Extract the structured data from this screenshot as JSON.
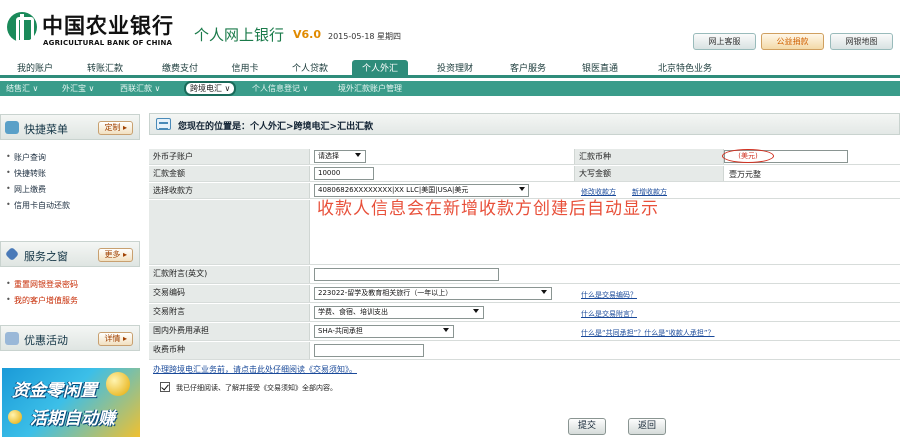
{
  "header": {
    "bank_name_cn": "中国农业银行",
    "bank_name_en": "AGRICULTURAL BANK OF CHINA",
    "product": "个人网上银行",
    "version": "V6.0",
    "date": "2015-05-18 星期四",
    "buttons": [
      "网上客服",
      "公益捐款",
      "网银地图"
    ]
  },
  "nav": {
    "items": [
      "我的账户",
      "转账汇款",
      "缴费支付",
      "信用卡",
      "个人贷款",
      "个人外汇",
      "投资理财",
      "客户服务",
      "银医直通",
      "北京特色业务"
    ],
    "active_index": 5
  },
  "subnav": {
    "items": [
      "结售汇 ∨",
      "外汇宝 ∨",
      "西联汇款 ∨",
      "跨境电汇 ∨",
      "个人信息登记 ∨",
      "境外汇款账户管理"
    ],
    "active_index": 3
  },
  "sidebar": {
    "quick_menu": {
      "title": "快捷菜单",
      "button": "定制 ▸",
      "links": [
        "账户查询",
        "快捷转账",
        "网上缴费",
        "信用卡自动还款"
      ]
    },
    "service": {
      "title": "服务之窗",
      "button": "更多 ▸",
      "links": [
        "重置网银登录密码",
        "我的客户增值服务"
      ]
    },
    "offers": {
      "title": "优惠活动",
      "button": "详情 ▸"
    },
    "promo": {
      "line1": "资金零闲置",
      "line2": "活期自动赚"
    }
  },
  "breadcrumb": "您现在的位置是：个人外汇>跨境电汇>汇出汇款",
  "form": {
    "account": {
      "label": "外币子账户",
      "value": "请选择"
    },
    "currency": {
      "label": "汇款币种",
      "value": "(美元)"
    },
    "amount": {
      "label": "汇款金额",
      "value": "10000"
    },
    "amount_upper": {
      "label": "大写金额",
      "value": "壹万元整"
    },
    "payee": {
      "label": "选择收款方",
      "value": "40806826XXXXXXXX|XX LLC|美国|USA|美元",
      "links": [
        "修改收款方",
        "新增收款方"
      ]
    },
    "notice": "收款人信息会在新增收款方创建后自动显示",
    "postscript": {
      "label": "汇款附言(英文)",
      "value": ""
    },
    "tx_code": {
      "label": "交易编码",
      "value": "223022-留学及教育相关旅行（一年以上）",
      "link": "什么是交易编码？"
    },
    "tx_postscript": {
      "label": "交易附言",
      "value": "学费、食宿、培训支出",
      "link": "什么是交易附言？"
    },
    "payer_type": {
      "label": "国内外费用承担",
      "value": "SHA-共同承担",
      "link": "什么是“共同承担”？什么是“收款人承担”？"
    },
    "fee_currency": {
      "label": "收费币种",
      "value": ""
    }
  },
  "bottom_link": "办理跨境电汇业务前，请点击此处仔细阅读《交易须知》。",
  "agree_text": "我已仔细阅读、了解并接受《交易须知》全部内容。",
  "actions": {
    "submit": "提交",
    "back": "返回"
  }
}
